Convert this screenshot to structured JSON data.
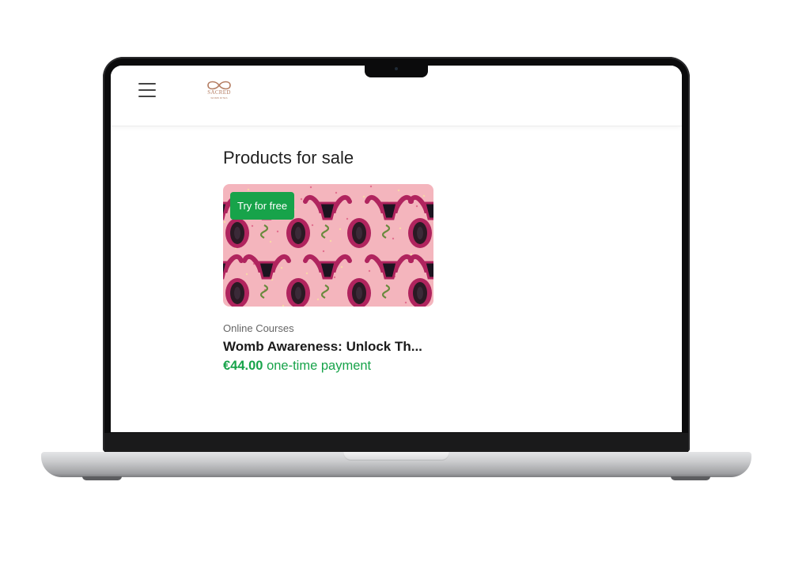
{
  "header": {
    "logo": {
      "text": "SACRED",
      "subtext": "WOMB RITES",
      "icon": "infinity-logo-icon"
    },
    "menu_icon": "hamburger-icon"
  },
  "main": {
    "title": "Products for sale",
    "products": [
      {
        "badge": "Try for free",
        "category": "Online Courses",
        "name": "Womb Awareness: Unlock Th...",
        "price": "€44.00",
        "price_note": "one-time payment"
      }
    ]
  },
  "colors": {
    "accent_green": "#17a34a",
    "logo_tan": "#b47d62",
    "thumb_pink": "#f4b5bd",
    "thumb_magenta": "#b0245e"
  }
}
